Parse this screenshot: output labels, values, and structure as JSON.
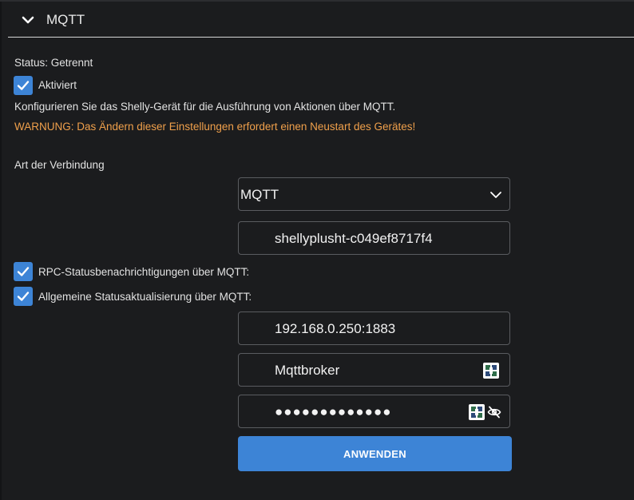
{
  "section": {
    "title": "MQTT",
    "expanded": true
  },
  "status_text": "Status: Getrennt",
  "enabled_checkbox": {
    "label": "Aktiviert",
    "checked": true
  },
  "description": "Konfigurieren Sie das Shelly-Gerät für die Ausführung von Aktionen über MQTT.",
  "warning": "WARNUNG: Das Ändern dieser Einstellungen erfordert einen Neustart des Gerätes!",
  "connection_type": {
    "label": "Art der Verbindung",
    "selected": "MQTT"
  },
  "client_id": {
    "value": "shellyplusht-c049ef8717f4"
  },
  "rpc_status_checkbox": {
    "label": "RPC-Statusbenachrichtigungen über MQTT:",
    "checked": true
  },
  "general_status_checkbox": {
    "label": "Allgemeine Statusaktualisierung über MQTT:",
    "checked": true
  },
  "server": {
    "value": "192.168.0.250:1883"
  },
  "username": {
    "value": "Mqttbroker"
  },
  "password": {
    "value": "●●●●●●●●●●●●●"
  },
  "apply_button": {
    "label": "ANWENDEN"
  },
  "colors": {
    "accent": "#3d84d6",
    "warning": "#f0a04b",
    "background": "#1b1c1e"
  }
}
